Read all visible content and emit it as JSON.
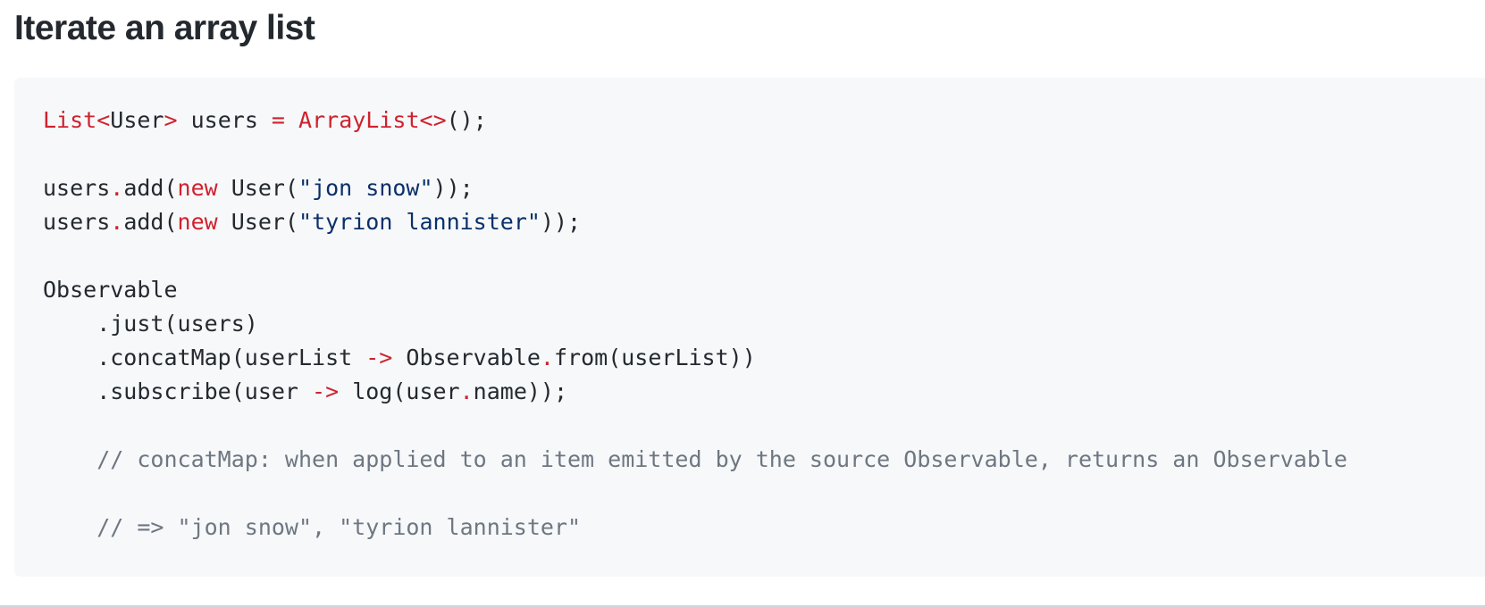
{
  "heading": "Iterate an array list",
  "code": {
    "l1": {
      "a": "List",
      "b": "<",
      "c": "User",
      "d": ">",
      "e": " users ",
      "f": "=",
      "g": " ",
      "h": "ArrayList",
      "i": "<>",
      "j": "();"
    },
    "l3": {
      "a": "users",
      "b": ".",
      "c": "add(",
      "d": "new",
      "e": " User(",
      "f": "\"jon snow\"",
      "g": "));"
    },
    "l4": {
      "a": "users",
      "b": ".",
      "c": "add(",
      "d": "new",
      "e": " User(",
      "f": "\"tyrion lannister\"",
      "g": "));"
    },
    "l6": {
      "a": "Observable"
    },
    "l7": {
      "a": "    .just(users)"
    },
    "l8": {
      "a": "    .concatMap(userList ",
      "b": "->",
      "c": " Observable",
      "d": ".",
      "e": "from(userList))"
    },
    "l9": {
      "a": "    .subscribe(user ",
      "b": "->",
      "c": " log(user",
      "d": ".",
      "e": "name));"
    },
    "l11": {
      "a": "    // concatMap: when applied to an item emitted by the source Observable, returns an Observable"
    },
    "l13": {
      "a": "    // => \"jon snow\", \"tyrion lannister\""
    }
  }
}
